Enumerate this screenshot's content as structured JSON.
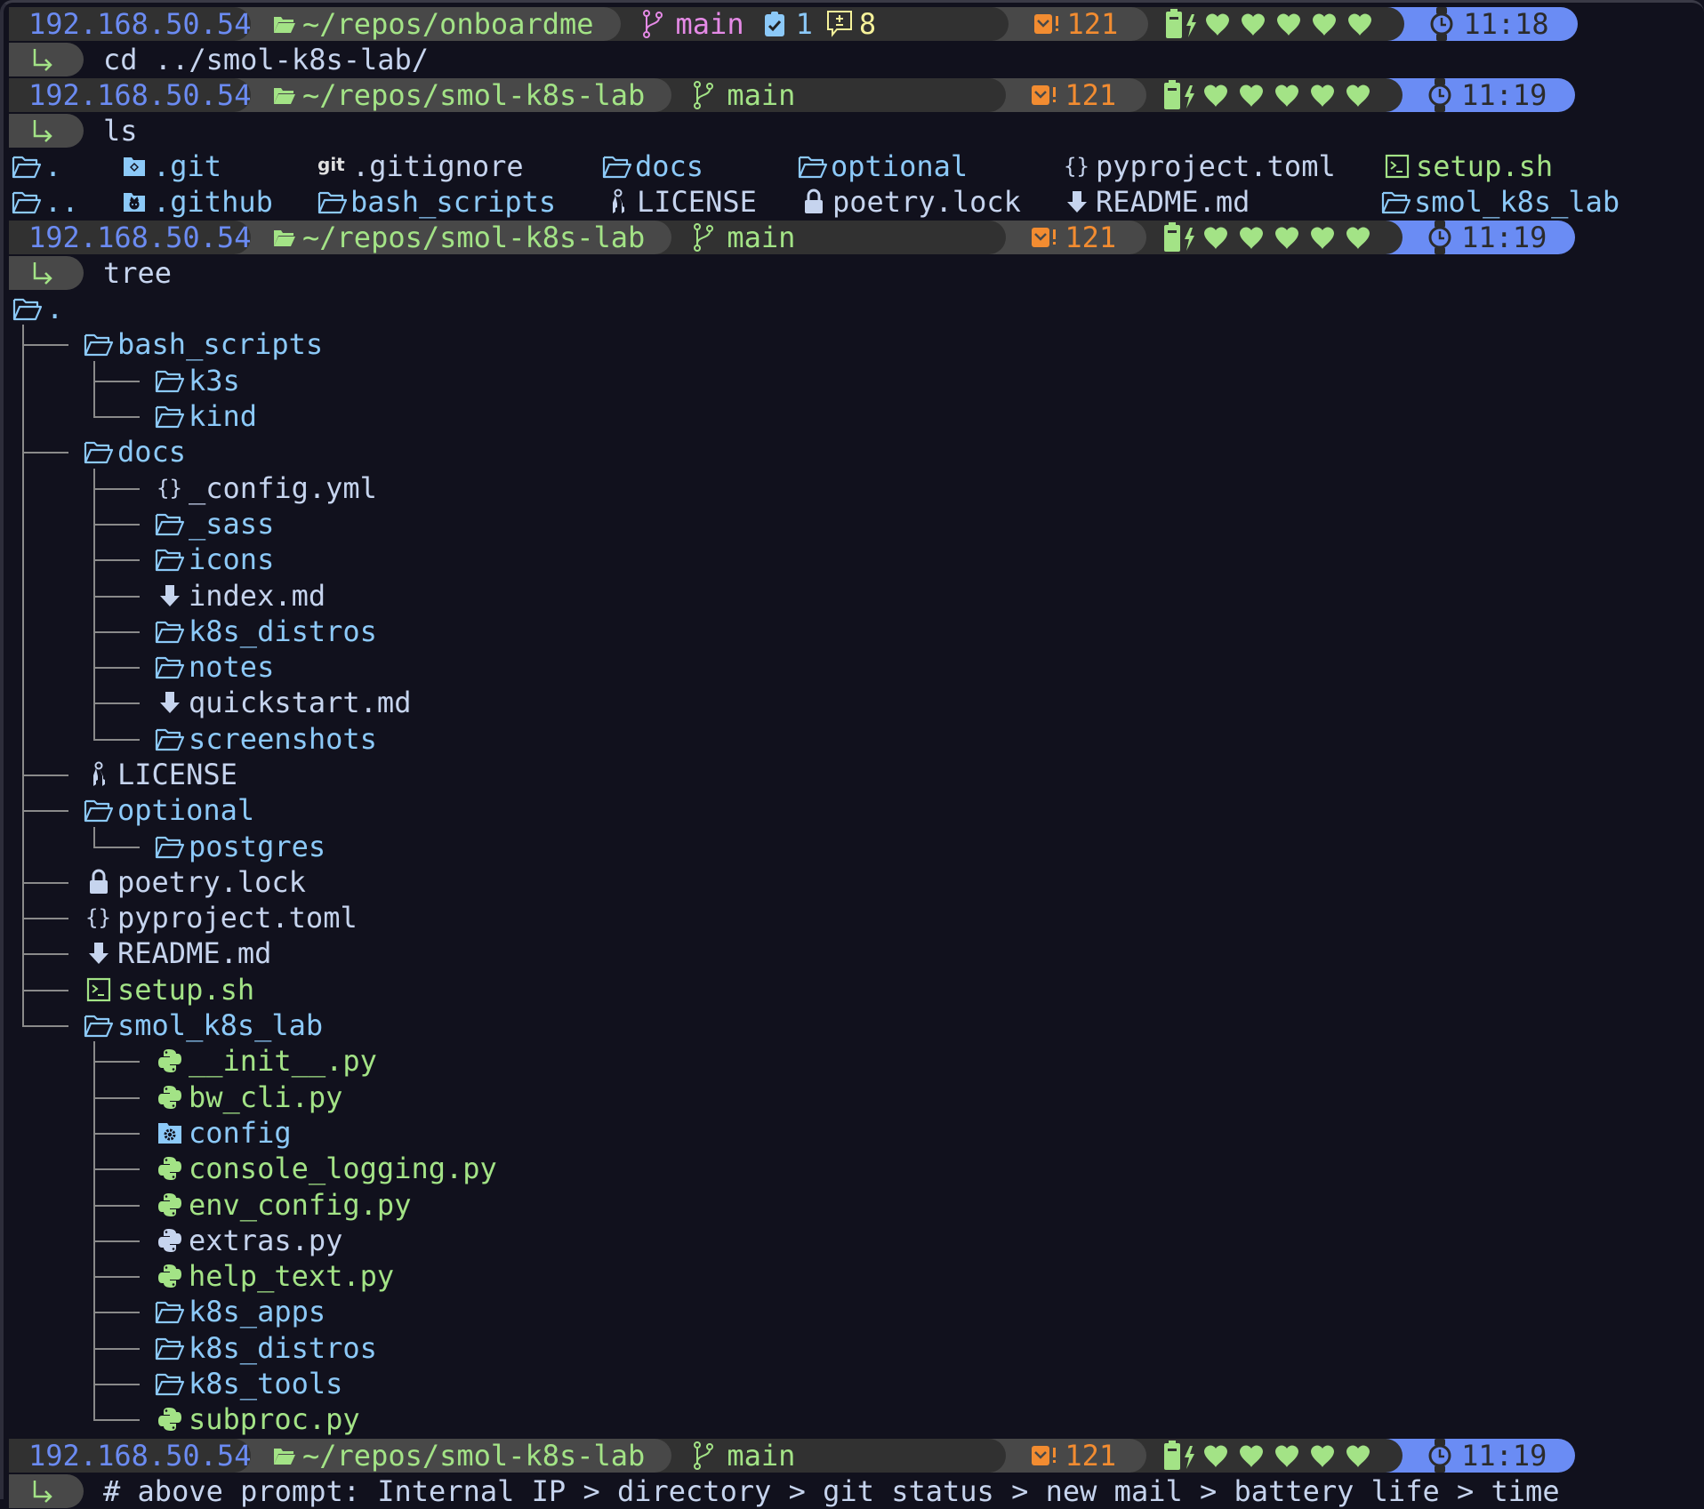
{
  "prompts": [
    {
      "ip": "192.168.50.54",
      "directory": "~/repos/onboardme",
      "git_branch": "main",
      "git_branch_color": "#e58ae6",
      "git_staged_count": "1",
      "git_modified_count": "8",
      "mail_count": "121",
      "battery_hearts": 5,
      "time": "11:18",
      "command": "cd ../smol-k8s-lab/"
    },
    {
      "ip": "192.168.50.54",
      "directory": "~/repos/smol-k8s-lab",
      "git_branch": "main",
      "git_branch_color": "#a3e386",
      "mail_count": "121",
      "battery_hearts": 5,
      "time": "11:19",
      "command": "ls"
    },
    {
      "ip": "192.168.50.54",
      "directory": "~/repos/smol-k8s-lab",
      "git_branch": "main",
      "git_branch_color": "#a3e386",
      "mail_count": "121",
      "battery_hearts": 5,
      "time": "11:19",
      "command": "tree"
    },
    {
      "ip": "192.168.50.54",
      "directory": "~/repos/smol-k8s-lab",
      "git_branch": "main",
      "git_branch_color": "#a3e386",
      "mail_count": "121",
      "battery_hearts": 5,
      "time": "11:19",
      "command": "# above prompt: Internal IP > directory > git status > new mail > battery life > time"
    }
  ],
  "ls_output": {
    "row1": [
      {
        "name": ".",
        "icon": "folder-open-icon",
        "type": "dir"
      },
      {
        "name": ".git",
        "icon": "git-folder-icon",
        "type": "dir"
      },
      {
        "name": ".gitignore",
        "icon": "git-icon",
        "type": "file"
      },
      {
        "name": "docs",
        "icon": "folder-open-icon",
        "type": "dir"
      },
      {
        "name": "optional",
        "icon": "folder-open-icon",
        "type": "dir"
      },
      {
        "name": "pyproject.toml",
        "icon": "braces-icon",
        "type": "file"
      },
      {
        "name": "setup.sh",
        "icon": "terminal-icon",
        "type": "exec"
      }
    ],
    "row2": [
      {
        "name": "..",
        "icon": "folder-open-icon",
        "type": "dir"
      },
      {
        "name": ".github",
        "icon": "github-folder-icon",
        "type": "dir"
      },
      {
        "name": "bash_scripts",
        "icon": "folder-open-icon",
        "type": "dir"
      },
      {
        "name": "LICENSE",
        "icon": "keys-icon",
        "type": "file"
      },
      {
        "name": "poetry.lock",
        "icon": "lock-icon",
        "type": "file"
      },
      {
        "name": "README.md",
        "icon": "markdown-arrow-icon",
        "type": "file"
      },
      {
        "name": "smol_k8s_lab",
        "icon": "folder-open-icon",
        "type": "dir"
      }
    ]
  },
  "tree_output": [
    {
      "name": ".",
      "depth": 0,
      "icon": "folder-open-icon",
      "type": "dir"
    },
    {
      "name": "bash_scripts",
      "depth": 1,
      "icon": "folder-open-icon",
      "type": "dir"
    },
    {
      "name": "k3s",
      "depth": 2,
      "icon": "folder-open-icon",
      "type": "dir"
    },
    {
      "name": "kind",
      "depth": 2,
      "icon": "folder-open-icon",
      "type": "dir",
      "last": true
    },
    {
      "name": "docs",
      "depth": 1,
      "icon": "folder-open-icon",
      "type": "dir"
    },
    {
      "name": "_config.yml",
      "depth": 2,
      "icon": "braces-icon",
      "type": "file"
    },
    {
      "name": "_sass",
      "depth": 2,
      "icon": "folder-open-icon",
      "type": "dir"
    },
    {
      "name": "icons",
      "depth": 2,
      "icon": "folder-open-icon",
      "type": "dir"
    },
    {
      "name": "index.md",
      "depth": 2,
      "icon": "markdown-arrow-icon",
      "type": "file"
    },
    {
      "name": "k8s_distros",
      "depth": 2,
      "icon": "folder-open-icon",
      "type": "dir"
    },
    {
      "name": "notes",
      "depth": 2,
      "icon": "folder-open-icon",
      "type": "dir"
    },
    {
      "name": "quickstart.md",
      "depth": 2,
      "icon": "markdown-arrow-icon",
      "type": "file"
    },
    {
      "name": "screenshots",
      "depth": 2,
      "icon": "folder-open-icon",
      "type": "dir",
      "last": true
    },
    {
      "name": "LICENSE",
      "depth": 1,
      "icon": "keys-icon",
      "type": "file"
    },
    {
      "name": "optional",
      "depth": 1,
      "icon": "folder-open-icon",
      "type": "dir"
    },
    {
      "name": "postgres",
      "depth": 2,
      "icon": "folder-open-icon",
      "type": "dir",
      "last": true
    },
    {
      "name": "poetry.lock",
      "depth": 1,
      "icon": "lock-icon",
      "type": "file"
    },
    {
      "name": "pyproject.toml",
      "depth": 1,
      "icon": "braces-icon",
      "type": "file"
    },
    {
      "name": "README.md",
      "depth": 1,
      "icon": "markdown-arrow-icon",
      "type": "file"
    },
    {
      "name": "setup.sh",
      "depth": 1,
      "icon": "terminal-icon",
      "type": "exec"
    },
    {
      "name": "smol_k8s_lab",
      "depth": 1,
      "icon": "folder-open-icon",
      "type": "dir",
      "last": true
    },
    {
      "name": "__init__.py",
      "depth": 2,
      "icon": "python-icon",
      "type": "py"
    },
    {
      "name": "bw_cli.py",
      "depth": 2,
      "icon": "python-icon",
      "type": "py"
    },
    {
      "name": "config",
      "depth": 2,
      "icon": "config-folder-icon",
      "type": "dir"
    },
    {
      "name": "console_logging.py",
      "depth": 2,
      "icon": "python-icon",
      "type": "py"
    },
    {
      "name": "env_config.py",
      "depth": 2,
      "icon": "python-icon",
      "type": "py"
    },
    {
      "name": "extras.py",
      "depth": 2,
      "icon": "python-icon",
      "type": "pyfile"
    },
    {
      "name": "help_text.py",
      "depth": 2,
      "icon": "python-icon",
      "type": "py"
    },
    {
      "name": "k8s_apps",
      "depth": 2,
      "icon": "folder-open-icon",
      "type": "dir"
    },
    {
      "name": "k8s_distros",
      "depth": 2,
      "icon": "folder-open-icon",
      "type": "dir"
    },
    {
      "name": "k8s_tools",
      "depth": 2,
      "icon": "folder-open-icon",
      "type": "dir"
    },
    {
      "name": "subproc.py",
      "depth": 2,
      "icon": "python-icon",
      "type": "py",
      "last": true
    }
  ],
  "colors": {
    "background": "#11111d",
    "ip": "#6b8bf2",
    "directory": "#a3e386",
    "folder": "#8cc9f8",
    "file": "#c6d4ee",
    "mail": "#f28c31",
    "time_bg": "#6a8cf4",
    "git_pink": "#e58ae6",
    "git_staged": "#8cc9f8",
    "git_modified": "#f6f29a"
  }
}
